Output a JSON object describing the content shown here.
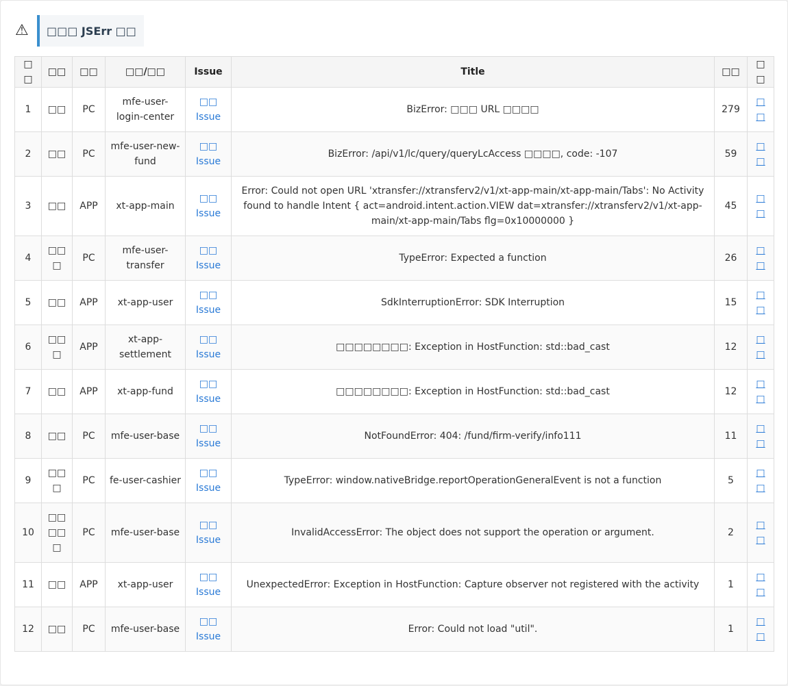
{
  "header": {
    "icon": "warning-icon",
    "icon_glyph": "⚠",
    "title": "□□□ JSErr □□"
  },
  "table": {
    "columns": [
      "□□",
      "□□",
      "□□",
      "□□/□□",
      "Issue",
      "Title",
      "□□",
      "□□"
    ],
    "rows": [
      {
        "index": "1",
        "owner": "□□",
        "platform": "PC",
        "app": "mfe-user-login-center",
        "issue": "□□ Issue",
        "title": "BizError: □□□ URL □□□□",
        "count": "279",
        "action": "□□"
      },
      {
        "index": "2",
        "owner": "□□",
        "platform": "PC",
        "app": "mfe-user-new-fund",
        "issue": "□□ Issue",
        "title": "BizError: /api/v1/lc/query/queryLcAccess □□□□, code: -107",
        "count": "59",
        "action": "□□"
      },
      {
        "index": "3",
        "owner": "□□",
        "platform": "APP",
        "app": "xt-app-main",
        "issue": "□□ Issue",
        "title": "Error: Could not open URL 'xtransfer://xtransferv2/v1/xt-app-main/xt-app-main/Tabs': No Activity found to handle Intent { act=android.intent.action.VIEW dat=xtransfer://xtransferv2/v1/xt-app-main/xt-app-main/Tabs flg=0x10000000 }",
        "count": "45",
        "action": "□□"
      },
      {
        "index": "4",
        "owner": "□□□",
        "platform": "PC",
        "app": "mfe-user-transfer",
        "issue": "□□ Issue",
        "title": "TypeError: Expected a function",
        "count": "26",
        "action": "□□"
      },
      {
        "index": "5",
        "owner": "□□",
        "platform": "APP",
        "app": "xt-app-user",
        "issue": "□□ Issue",
        "title": "SdkInterruptionError: SDK Interruption",
        "count": "15",
        "action": "□□"
      },
      {
        "index": "6",
        "owner": "□□□",
        "platform": "APP",
        "app": "xt-app-settlement",
        "issue": "□□ Issue",
        "title": "□□□□□□□□: Exception in HostFunction: std::bad_cast",
        "count": "12",
        "action": "□□"
      },
      {
        "index": "7",
        "owner": "□□",
        "platform": "APP",
        "app": "xt-app-fund",
        "issue": "□□ Issue",
        "title": "□□□□□□□□: Exception in HostFunction: std::bad_cast",
        "count": "12",
        "action": "□□"
      },
      {
        "index": "8",
        "owner": "□□",
        "platform": "PC",
        "app": "mfe-user-base",
        "issue": "□□ Issue",
        "title": "NotFoundError: 404: /fund/firm-verify/info111",
        "count": "11",
        "action": "□□"
      },
      {
        "index": "9",
        "owner": "□□□",
        "platform": "PC",
        "app": "fe-user-cashier",
        "issue": "□□ Issue",
        "title": "TypeError: window.nativeBridge.reportOperationGeneralEvent is not a function",
        "count": "5",
        "action": "□□"
      },
      {
        "index": "10",
        "owner": "□□□□□",
        "platform": "PC",
        "app": "mfe-user-base",
        "issue": "□□ Issue",
        "title": "InvalidAccessError: The object does not support the operation or argument.",
        "count": "2",
        "action": "□□"
      },
      {
        "index": "11",
        "owner": "□□",
        "platform": "APP",
        "app": "xt-app-user",
        "issue": "□□ Issue",
        "title": "UnexpectedError: Exception in HostFunction: Capture observer not registered with the activity",
        "count": "1",
        "action": "□□"
      },
      {
        "index": "12",
        "owner": "□□",
        "platform": "PC",
        "app": "mfe-user-base",
        "issue": "□□ Issue",
        "title": "Error: Could not load \"util\".",
        "count": "1",
        "action": "□□"
      }
    ]
  },
  "colors": {
    "accent": "#3a8fce",
    "link": "#2a7ad6",
    "header_bg": "#f5f5f5",
    "border": "#dddddd"
  }
}
